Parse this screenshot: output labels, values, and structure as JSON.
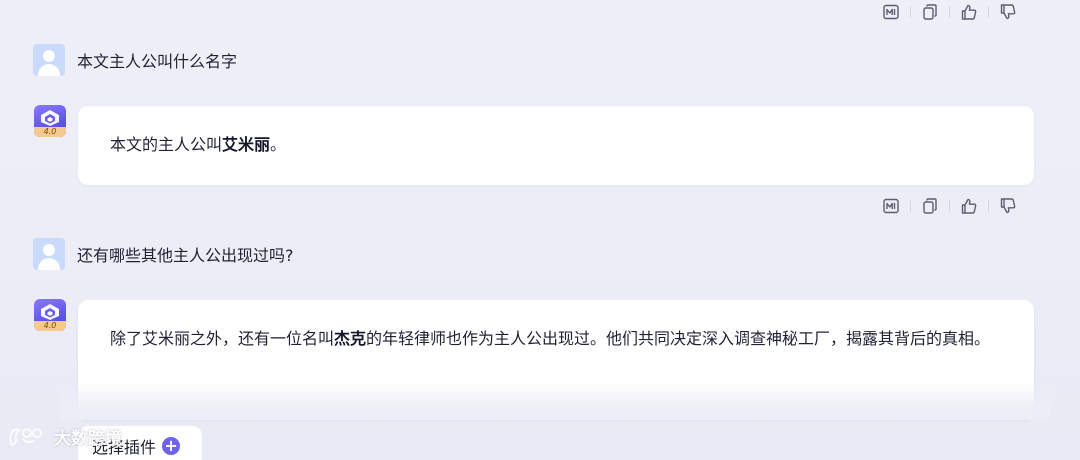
{
  "toolbar_icons": [
    "report-icon",
    "copy-icon",
    "thumbs-up-icon",
    "thumbs-down-icon"
  ],
  "messages": [
    {
      "role": "user",
      "text": "本文主人公叫什么名字"
    },
    {
      "role": "assistant",
      "avatar_version": "4.0",
      "segments": [
        {
          "text": "本文的主人公叫",
          "bold": false
        },
        {
          "text": "艾米丽",
          "bold": true
        },
        {
          "text": "。",
          "bold": false
        }
      ]
    },
    {
      "role": "user",
      "text": "还有哪些其他主人公出现过吗?"
    },
    {
      "role": "assistant",
      "avatar_version": "4.0",
      "segments": [
        {
          "text": "除了艾米丽之外，还有一位名叫",
          "bold": false
        },
        {
          "text": "杰克",
          "bold": true
        },
        {
          "text": "的年轻律师也作为主人公出现过。他们共同决定深入调查神秘工厂，揭露其背后的真相。",
          "bold": false
        }
      ]
    }
  ],
  "composer": {
    "plugin_label": "选择插件",
    "plugin_plus": "+"
  },
  "watermark": {
    "text": "大数跨境"
  },
  "colors": {
    "accent": "#6f62f0",
    "background": "#ecedf6",
    "bubble": "#ffffff",
    "user_avatar": "#c9dafb"
  }
}
